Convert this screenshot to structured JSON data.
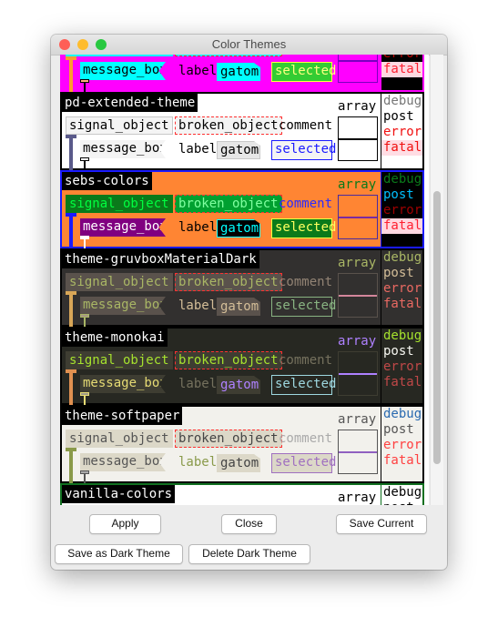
{
  "window": {
    "title": "Color Themes"
  },
  "labels": {
    "signal": "signal_object",
    "broken": "broken_object",
    "comment": "comment",
    "array": "array",
    "message": "message_box",
    "label": "label",
    "gatom": "gatom",
    "selected": "selected",
    "debug": "debug",
    "post": "post",
    "error": "error",
    "fatal": "fatal"
  },
  "themes": [
    {
      "name": "",
      "border": "#ff00ff",
      "bg": "#ff00ff",
      "objBg": "#00ffff",
      "objText": "#000",
      "brokenBg": "#00ffff",
      "brokenText": "#000",
      "comment": "#000",
      "arrayLabel": "#000",
      "arrayBorder": "#7a00c0",
      "arrayBg": "#ff00ff",
      "arrayLine": "#7a00c0",
      "msgBg": "#00ffff",
      "msgText": "#000",
      "labelText": "#000",
      "gatomBg": "#00ffff",
      "gatomText": "#000",
      "gatomBorder": "#00ffff",
      "selBg": "#33cc33",
      "selText": "#ffff80",
      "selBorder": "#ffff40",
      "cord": "#ff9a30",
      "dbgBg": "#000",
      "debug": "#000",
      "post": "#000",
      "error": "#c00000",
      "fatal": "#ff2030",
      "fatalBg": "#ffd8e0",
      "inletColor": "#ffb080"
    },
    {
      "name": "pd-extended-theme",
      "border": "#000",
      "bg": "#fff",
      "objBg": "#f4f4f4",
      "objText": "#000",
      "objBorder": "#c8c8c8",
      "brokenBg": "#f4f4f4",
      "brokenText": "#000",
      "comment": "#000",
      "arrayLabel": "#000",
      "arrayBorder": "#000",
      "arrayBg": "#fff",
      "arrayLine": "#000",
      "msgBg": "#f4f4f4",
      "msgText": "#000",
      "labelText": "#000",
      "gatomBg": "#e6e6e6",
      "gatomText": "#000",
      "gatomBorder": "#c8c8c8",
      "selBg": "#f4f4f4",
      "selText": "#1a1aff",
      "selBorder": "#1a1aff",
      "cord": "#5a5a8a",
      "dbgBg": "#fff",
      "debug": "#777",
      "post": "#000",
      "error": "#f01010",
      "fatal": "#f01010",
      "fatalBg": "#ffdde4",
      "inletColor": "#fff"
    },
    {
      "name": "sebs-colors",
      "border": "#1a1aff",
      "bg": "#ff8533",
      "objBg": "#0a7a1a",
      "objText": "#00ff40",
      "objBorder": "#0a7a1a",
      "brokenBg": "#00a030",
      "brokenText": "#80ffa0",
      "comment": "#2a2aff",
      "arrayLabel": "#0a7a1a",
      "arrayBorder": "#4a2aa0",
      "arrayBg": "#ff8533",
      "arrayLine": "#7a2aa0",
      "msgBg": "#800080",
      "msgText": "#fff",
      "labelText": "#000",
      "gatomBg": "#000",
      "gatomText": "#00ffff",
      "gatomBorder": "#00ffff",
      "selBg": "#0a7a1a",
      "selText": "#ffff60",
      "selBorder": "#ffff40",
      "cord": "#1a1aff",
      "dbgBg": "#000",
      "debug": "#0a7a1a",
      "post": "#00c0ff",
      "error": "#a00000",
      "fatal": "#ff2030",
      "fatalBg": "#ffd8e0",
      "inletColor": "#fff"
    },
    {
      "name": "theme-gruvboxMaterialDark",
      "border": "#000",
      "bg": "#32302f",
      "objBg": "#5a524c",
      "objText": "#a9b665",
      "objBorder": "#5a524c",
      "brokenBg": "#5a524c",
      "brokenText": "#a9b665",
      "comment": "#928374",
      "arrayLabel": "#a9b665",
      "arrayBorder": "#5a524c",
      "arrayBg": "#32302f",
      "arrayLine": "#d3869b",
      "msgBg": "#5a524c",
      "msgText": "#a9b665",
      "labelText": "#d4be98",
      "gatomBg": "#5a524c",
      "gatomText": "#d4be98",
      "gatomBorder": "#5a524c",
      "selBg": "#32302f",
      "selText": "#89b482",
      "selBorder": "#89b482",
      "cord": "#d8a657",
      "dbgBg": "#32302f",
      "debug": "#a9b665",
      "post": "#d4be98",
      "error": "#ea6962",
      "fatal": "#ea6962",
      "fatalBg": "#32302f",
      "inletColor": "#a89984"
    },
    {
      "name": "theme-monokai",
      "border": "#000",
      "bg": "#272822",
      "objBg": "#3e3d32",
      "objText": "#a6e22e",
      "objBorder": "#3e3d32",
      "brokenBg": "#3e3d32",
      "brokenText": "#a6e22e",
      "comment": "#75715e",
      "arrayLabel": "#ae81ff",
      "arrayBorder": "#3e3d32",
      "arrayBg": "#272822",
      "arrayLine": "#ae81ff",
      "msgBg": "#3e3d32",
      "msgText": "#e6db74",
      "labelText": "#75715e",
      "gatomBg": "#3e3d32",
      "gatomText": "#ae81ff",
      "gatomBorder": "#3e3d32",
      "selBg": "#272822",
      "selText": "#9ed8e0",
      "selBorder": "#9ed8e0",
      "cord": "#e09050",
      "dbgBg": "#272822",
      "debug": "#a6e22e",
      "post": "#f8f8f2",
      "error": "#c04848",
      "fatal": "#c04848",
      "fatalBg": "#272822",
      "inletColor": "#a09a88"
    },
    {
      "name": "theme-softpaper",
      "border": "#000",
      "bg": "#f2f1ec",
      "objBg": "#dcd8c8",
      "objText": "#555",
      "objBorder": "#dcd8c8",
      "brokenBg": "#dcd8c8",
      "brokenText": "#444",
      "comment": "#aaa",
      "arrayLabel": "#555",
      "arrayBorder": "#555",
      "arrayBg": "#f2f1ec",
      "arrayLine": "#9060c0",
      "msgBg": "#dcd8c8",
      "msgText": "#555",
      "labelText": "#8a9a4a",
      "gatomBg": "#dcd8c8",
      "gatomText": "#444",
      "gatomBorder": "#dcd8c8",
      "selBg": "#dcd8c8",
      "selText": "#a070c0",
      "selBorder": "#a070c0",
      "cord": "#8a9a4a",
      "dbgBg": "#f2f1ec",
      "debug": "#2a6ab0",
      "post": "#555",
      "error": "#ff4040",
      "fatal": "#ff4040",
      "fatalBg": "#f2f1ec",
      "inletColor": "#aaa"
    },
    {
      "name": "vanilla-colors",
      "border": "#107020",
      "bg": "#fff",
      "objBg": "#fff",
      "objText": "#000",
      "objBorder": "#000",
      "brokenBg": "#fff",
      "brokenText": "#000",
      "comment": "#000",
      "arrayLabel": "#000",
      "arrayBorder": "#000",
      "arrayBg": "#fff",
      "arrayLine": "#000",
      "msgBg": "#fff",
      "msgText": "#000",
      "labelText": "#000",
      "gatomBg": "#fff",
      "gatomText": "#000",
      "gatomBorder": "#000",
      "selBg": "#fff",
      "selText": "#00f",
      "selBorder": "#00f",
      "cord": "#000",
      "dbgBg": "#fff",
      "debug": "#000",
      "post": "#000",
      "error": "#f00",
      "fatal": "#f00",
      "fatalBg": "#fff",
      "inletColor": "#fff"
    }
  ],
  "buttons": {
    "apply": "Apply",
    "close": "Close",
    "save_current": "Save Current",
    "save_dark": "Save as Dark Theme",
    "delete_dark": "Delete Dark Theme"
  }
}
